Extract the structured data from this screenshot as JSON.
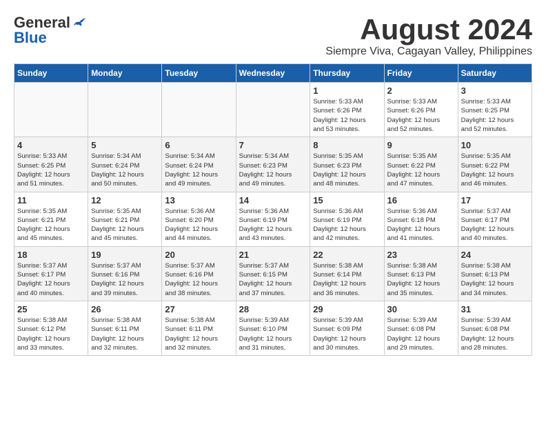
{
  "header": {
    "logo_general": "General",
    "logo_blue": "Blue",
    "main_title": "August 2024",
    "subtitle": "Siempre Viva, Cagayan Valley, Philippines"
  },
  "days_of_week": [
    "Sunday",
    "Monday",
    "Tuesday",
    "Wednesday",
    "Thursday",
    "Friday",
    "Saturday"
  ],
  "weeks": [
    {
      "days": [
        {
          "num": "",
          "info": ""
        },
        {
          "num": "",
          "info": ""
        },
        {
          "num": "",
          "info": ""
        },
        {
          "num": "",
          "info": ""
        },
        {
          "num": "1",
          "info": "Sunrise: 5:33 AM\nSunset: 6:26 PM\nDaylight: 12 hours\nand 53 minutes."
        },
        {
          "num": "2",
          "info": "Sunrise: 5:33 AM\nSunset: 6:26 PM\nDaylight: 12 hours\nand 52 minutes."
        },
        {
          "num": "3",
          "info": "Sunrise: 5:33 AM\nSunset: 6:25 PM\nDaylight: 12 hours\nand 52 minutes."
        }
      ]
    },
    {
      "days": [
        {
          "num": "4",
          "info": "Sunrise: 5:33 AM\nSunset: 6:25 PM\nDaylight: 12 hours\nand 51 minutes."
        },
        {
          "num": "5",
          "info": "Sunrise: 5:34 AM\nSunset: 6:24 PM\nDaylight: 12 hours\nand 50 minutes."
        },
        {
          "num": "6",
          "info": "Sunrise: 5:34 AM\nSunset: 6:24 PM\nDaylight: 12 hours\nand 49 minutes."
        },
        {
          "num": "7",
          "info": "Sunrise: 5:34 AM\nSunset: 6:23 PM\nDaylight: 12 hours\nand 49 minutes."
        },
        {
          "num": "8",
          "info": "Sunrise: 5:35 AM\nSunset: 6:23 PM\nDaylight: 12 hours\nand 48 minutes."
        },
        {
          "num": "9",
          "info": "Sunrise: 5:35 AM\nSunset: 6:22 PM\nDaylight: 12 hours\nand 47 minutes."
        },
        {
          "num": "10",
          "info": "Sunrise: 5:35 AM\nSunset: 6:22 PM\nDaylight: 12 hours\nand 46 minutes."
        }
      ]
    },
    {
      "days": [
        {
          "num": "11",
          "info": "Sunrise: 5:35 AM\nSunset: 6:21 PM\nDaylight: 12 hours\nand 45 minutes."
        },
        {
          "num": "12",
          "info": "Sunrise: 5:35 AM\nSunset: 6:21 PM\nDaylight: 12 hours\nand 45 minutes."
        },
        {
          "num": "13",
          "info": "Sunrise: 5:36 AM\nSunset: 6:20 PM\nDaylight: 12 hours\nand 44 minutes."
        },
        {
          "num": "14",
          "info": "Sunrise: 5:36 AM\nSunset: 6:19 PM\nDaylight: 12 hours\nand 43 minutes."
        },
        {
          "num": "15",
          "info": "Sunrise: 5:36 AM\nSunset: 6:19 PM\nDaylight: 12 hours\nand 42 minutes."
        },
        {
          "num": "16",
          "info": "Sunrise: 5:36 AM\nSunset: 6:18 PM\nDaylight: 12 hours\nand 41 minutes."
        },
        {
          "num": "17",
          "info": "Sunrise: 5:37 AM\nSunset: 6:17 PM\nDaylight: 12 hours\nand 40 minutes."
        }
      ]
    },
    {
      "days": [
        {
          "num": "18",
          "info": "Sunrise: 5:37 AM\nSunset: 6:17 PM\nDaylight: 12 hours\nand 40 minutes."
        },
        {
          "num": "19",
          "info": "Sunrise: 5:37 AM\nSunset: 6:16 PM\nDaylight: 12 hours\nand 39 minutes."
        },
        {
          "num": "20",
          "info": "Sunrise: 5:37 AM\nSunset: 6:16 PM\nDaylight: 12 hours\nand 38 minutes."
        },
        {
          "num": "21",
          "info": "Sunrise: 5:37 AM\nSunset: 6:15 PM\nDaylight: 12 hours\nand 37 minutes."
        },
        {
          "num": "22",
          "info": "Sunrise: 5:38 AM\nSunset: 6:14 PM\nDaylight: 12 hours\nand 36 minutes."
        },
        {
          "num": "23",
          "info": "Sunrise: 5:38 AM\nSunset: 6:13 PM\nDaylight: 12 hours\nand 35 minutes."
        },
        {
          "num": "24",
          "info": "Sunrise: 5:38 AM\nSunset: 6:13 PM\nDaylight: 12 hours\nand 34 minutes."
        }
      ]
    },
    {
      "days": [
        {
          "num": "25",
          "info": "Sunrise: 5:38 AM\nSunset: 6:12 PM\nDaylight: 12 hours\nand 33 minutes."
        },
        {
          "num": "26",
          "info": "Sunrise: 5:38 AM\nSunset: 6:11 PM\nDaylight: 12 hours\nand 32 minutes."
        },
        {
          "num": "27",
          "info": "Sunrise: 5:38 AM\nSunset: 6:11 PM\nDaylight: 12 hours\nand 32 minutes."
        },
        {
          "num": "28",
          "info": "Sunrise: 5:39 AM\nSunset: 6:10 PM\nDaylight: 12 hours\nand 31 minutes."
        },
        {
          "num": "29",
          "info": "Sunrise: 5:39 AM\nSunset: 6:09 PM\nDaylight: 12 hours\nand 30 minutes."
        },
        {
          "num": "30",
          "info": "Sunrise: 5:39 AM\nSunset: 6:08 PM\nDaylight: 12 hours\nand 29 minutes."
        },
        {
          "num": "31",
          "info": "Sunrise: 5:39 AM\nSunset: 6:08 PM\nDaylight: 12 hours\nand 28 minutes."
        }
      ]
    }
  ]
}
